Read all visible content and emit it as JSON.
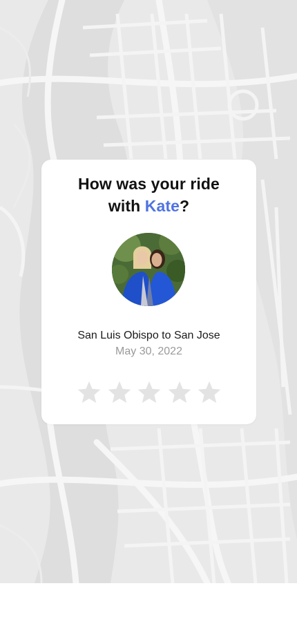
{
  "rating": {
    "title_prefix": "How was your ride",
    "title_with": "with",
    "driver_name": "Kate",
    "title_suffix": "?",
    "route": "San Luis Obispo to San Jose",
    "date": "May 30, 2022",
    "stars_total": 5,
    "stars_selected": 0,
    "accent_color": "#4f73e0",
    "star_empty_color": "#e3e3e3"
  },
  "map": {
    "background_color": "#e9e9e9",
    "road_color": "#f7f7f7"
  },
  "avatar": {
    "icon": "driver-photo"
  }
}
